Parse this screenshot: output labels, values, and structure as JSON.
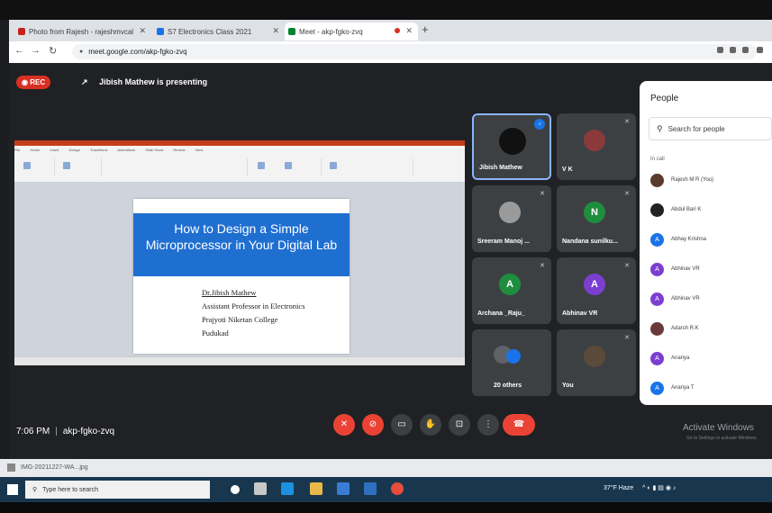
{
  "browser": {
    "tabs": [
      {
        "label": "Photo from Rajesh - rajeshmvcal",
        "color": "#c5221f"
      },
      {
        "label": "S7 Electronics Class 2021",
        "color": "#1a73e8"
      },
      {
        "label": "Meet - akp-fgko-zvq",
        "color": "#ffffff"
      }
    ],
    "url": "meet.google.com/akp-fgko-zvq"
  },
  "meet": {
    "rec_label": "REC",
    "presenting_text": "Jibish Mathew is presenting",
    "slide": {
      "title": "How to Design a Simple Microprocessor in Your Digital Lab",
      "author": "Dr.Jibish Mathew",
      "lines": [
        "Assistant Professor in Electronics",
        "Prajyoti Niketan College",
        "Pudukad"
      ]
    },
    "ppt_tabs": [
      "File",
      "Home",
      "Insert",
      "Design",
      "Transitions",
      "Animations",
      "Slide Show",
      "Review",
      "View"
    ],
    "tiles": [
      {
        "name": "Jibish Mathew",
        "initial": "",
        "color": "#3c4043"
      },
      {
        "name": "V K",
        "initial": "",
        "color": "#8a3a3a"
      },
      {
        "name": "Sreeram Manoj ...",
        "initial": "",
        "color": "#6b6b6b"
      },
      {
        "name": "Nandana sunilku...",
        "initial": "N",
        "color": "#1e8e3e"
      },
      {
        "name": "Archana _Raju_",
        "initial": "A",
        "color": "#1e8e3e"
      },
      {
        "name": "Abhinav VR",
        "initial": "A",
        "color": "#7b3fd0"
      },
      {
        "name": "20 others",
        "initial": "",
        "color": "#3c4043"
      },
      {
        "name": "You",
        "initial": "",
        "color": "#5a4a3a"
      }
    ],
    "people": {
      "title": "People",
      "search_placeholder": "Search for people",
      "in_call": "In call",
      "members": [
        {
          "name": "Rajesh M R (You)",
          "initial": "",
          "color": "#5a3a2a"
        },
        {
          "name": "Abdul Bari K",
          "initial": "",
          "color": "#222222"
        },
        {
          "name": "Abhay Krishna",
          "initial": "A",
          "color": "#1a73e8"
        },
        {
          "name": "Abhinav VR",
          "initial": "A",
          "color": "#7b3fd0"
        },
        {
          "name": "Abhinav VR",
          "initial": "A",
          "color": "#7b3fd0"
        },
        {
          "name": "Adarsh R.K",
          "initial": "",
          "color": "#6a3a3a"
        },
        {
          "name": "Ananya",
          "initial": "A",
          "color": "#7b3fd0"
        },
        {
          "name": "Ananya T",
          "initial": "A",
          "color": "#1a73e8"
        }
      ]
    },
    "time": "7:06 PM",
    "meeting_code": "akp-fgko-zvq",
    "activate_windows": "Activate Windows",
    "activate_sub": "Go to Settings to activate Windows."
  },
  "download": {
    "file": "IMG-20211227-WA...jpg"
  },
  "taskbar": {
    "search": "Type here to search",
    "tray": "37°F Haze"
  }
}
